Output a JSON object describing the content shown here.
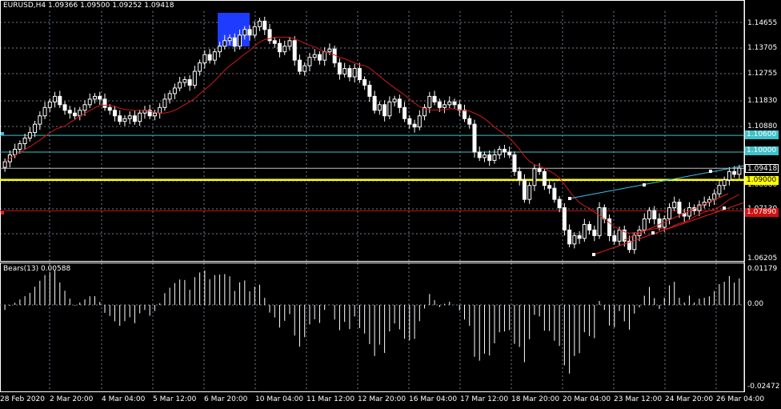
{
  "header": {
    "symbol": "EURUSD,H4",
    "open": "1.09366",
    "high": "1.09500",
    "low": "1.09252",
    "close": "1.09418"
  },
  "indicator": {
    "name": "Bears(13)",
    "value": "0.00588"
  },
  "price_axis": [
    "1.14655",
    "1.13705",
    "1.12755",
    "1.11830",
    "1.10880",
    "1.09418",
    "1.08080",
    "1.07130",
    "1.06205"
  ],
  "indicator_axis": [
    "0.01179",
    "0.00",
    "-0.02472"
  ],
  "levels": [
    {
      "label": "1.10600",
      "price": 1.106,
      "color": "#40c0c8",
      "label_bg": "#40c0c8"
    },
    {
      "label": "1.10000",
      "price": 1.1,
      "color": "#40c0c8",
      "label_bg": "#40c0c8"
    },
    {
      "label": "1.09000",
      "price": 1.09,
      "color": "#ffff00",
      "label_bg": "#ffff00"
    },
    {
      "label": "1.07890",
      "price": 1.0789,
      "color": "#d01010",
      "label_bg": "#d01010"
    }
  ],
  "current_price_label": "1.09418",
  "time_axis": [
    "28 Feb 2020",
    "2 Mar 20:00",
    "4 Mar 04:00",
    "5 Mar 12:00",
    "6 Mar 20:00",
    "10 Mar 04:00",
    "11 Mar 12:00",
    "12 Mar 20:00",
    "16 Mar 04:00",
    "17 Mar 12:00",
    "18 Mar 20:00",
    "20 Mar 04:00",
    "23 Mar 12:00",
    "24 Mar 20:00",
    "26 Mar 04:00"
  ],
  "colors": {
    "background": "#000000",
    "grid": "#6e7f8f",
    "bull": "#ffffff",
    "bear": "#ffffff",
    "ma": "#d01818",
    "trend_upper": "#40c0e8",
    "trend_lower": "#e02020",
    "highlight": "#1e3cff"
  },
  "chart_data": {
    "type": "line",
    "title": "EURUSD,H4",
    "ylim": [
      1.06205,
      1.14655
    ],
    "series": [
      {
        "name": "EURUSD,H4",
        "close": [
          1.0965,
          1.099,
          1.101,
          1.103,
          1.105,
          1.107,
          1.11,
          1.113,
          1.116,
          1.118,
          1.12,
          1.117,
          1.115,
          1.114,
          1.113,
          1.115,
          1.117,
          1.119,
          1.12,
          1.119,
          1.116,
          1.115,
          1.113,
          1.111,
          1.112,
          1.113,
          1.111,
          1.114,
          1.115,
          1.113,
          1.114,
          1.116,
          1.119,
          1.121,
          1.123,
          1.125,
          1.126,
          1.124,
          1.129,
          1.132,
          1.135,
          1.133,
          1.136,
          1.138,
          1.14,
          1.141,
          1.138,
          1.142,
          1.144,
          1.142,
          1.145,
          1.147,
          1.144,
          1.14,
          1.139,
          1.136,
          1.138,
          1.14,
          1.133,
          1.129,
          1.131,
          1.134,
          1.135,
          1.133,
          1.136,
          1.137,
          1.132,
          1.128,
          1.13,
          1.127,
          1.13,
          1.126,
          1.124,
          1.12,
          1.115,
          1.117,
          1.113,
          1.118,
          1.119,
          1.116,
          1.112,
          1.11,
          1.109,
          1.113,
          1.116,
          1.12,
          1.118,
          1.116,
          1.117,
          1.118,
          1.117,
          1.115,
          1.112,
          1.11,
          1.1,
          1.098,
          1.099,
          1.097,
          1.099,
          1.101,
          1.1,
          1.099,
          1.093,
          1.09,
          1.083,
          1.088,
          1.094,
          1.093,
          1.088,
          1.087,
          1.083,
          1.08,
          1.072,
          1.067,
          1.07,
          1.069,
          1.074,
          1.072,
          1.07,
          1.08,
          1.076,
          1.07,
          1.068,
          1.072,
          1.068,
          1.065,
          1.07,
          1.072,
          1.076,
          1.079,
          1.076,
          1.073,
          1.076,
          1.08,
          1.082,
          1.078,
          1.077,
          1.08,
          1.079,
          1.081,
          1.082,
          1.083,
          1.085,
          1.088,
          1.09,
          1.093,
          1.092,
          1.0942
        ]
      }
    ]
  }
}
